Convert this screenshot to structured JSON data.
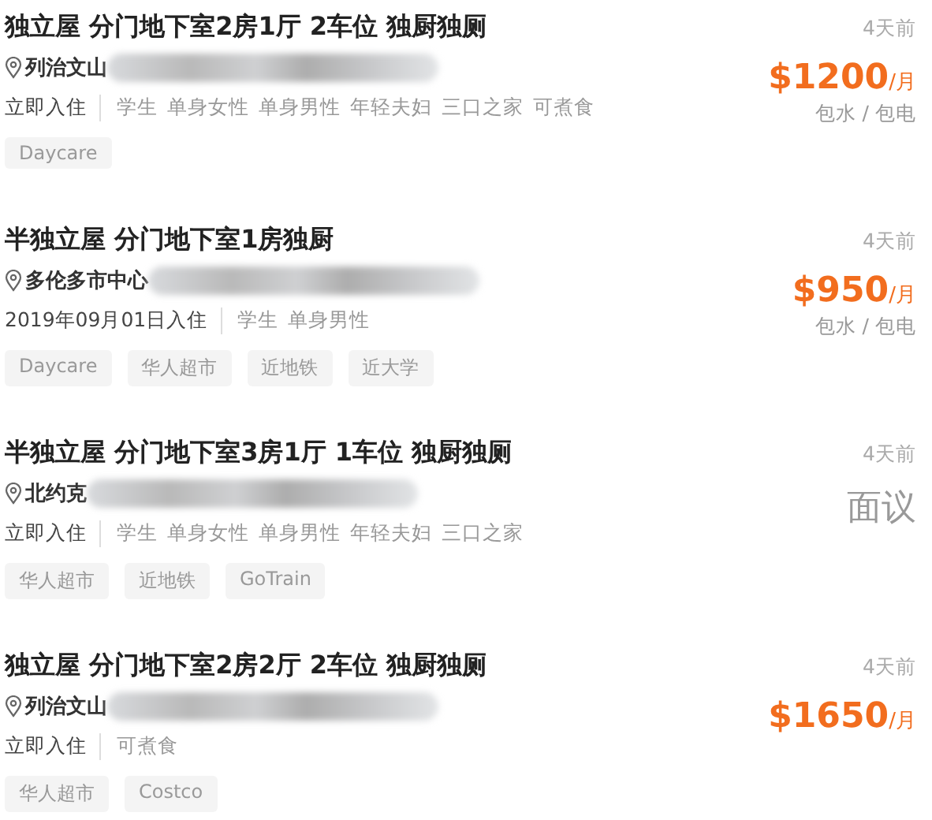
{
  "listings": [
    {
      "title": "独立屋 分门地下室2房1厅 2车位 独厨独厕",
      "location": "列治文山",
      "move_in": "立即入住",
      "tenants": [
        "学生",
        "单身女性",
        "单身男性",
        "年轻夫妇",
        "三口之家",
        "可煮食"
      ],
      "tags": [
        "Daycare"
      ],
      "posted": "4天前",
      "price": {
        "kind": "amount",
        "amount": "$1200",
        "unit": "/月"
      },
      "utilities": "包水 / 包电"
    },
    {
      "title": "半独立屋 分门地下室1房独厨",
      "location": "多伦多市中心",
      "move_in": "2019年09月01日入住",
      "tenants": [
        "学生",
        "单身男性"
      ],
      "tags": [
        "Daycare",
        "华人超市",
        "近地铁",
        "近大学"
      ],
      "posted": "4天前",
      "price": {
        "kind": "amount",
        "amount": "$950",
        "unit": "/月"
      },
      "utilities": "包水 / 包电"
    },
    {
      "title": "半独立屋 分门地下室3房1厅 1车位 独厨独厕",
      "location": "北约克",
      "move_in": "立即入住",
      "tenants": [
        "学生",
        "单身女性",
        "单身男性",
        "年轻夫妇",
        "三口之家"
      ],
      "tags": [
        "华人超市",
        "近地铁",
        "GoTrain"
      ],
      "posted": "4天前",
      "price": {
        "kind": "negotiable",
        "text": "面议"
      }
    },
    {
      "title": "独立屋 分门地下室2房2厅 2车位 独厨独厕",
      "location": "列治文山",
      "move_in": "立即入住",
      "tenants": [
        "可煮食"
      ],
      "tags": [
        "华人超市",
        "Costco"
      ],
      "posted": "4天前",
      "price": {
        "kind": "amount",
        "amount": "$1650",
        "unit": "/月"
      }
    }
  ]
}
